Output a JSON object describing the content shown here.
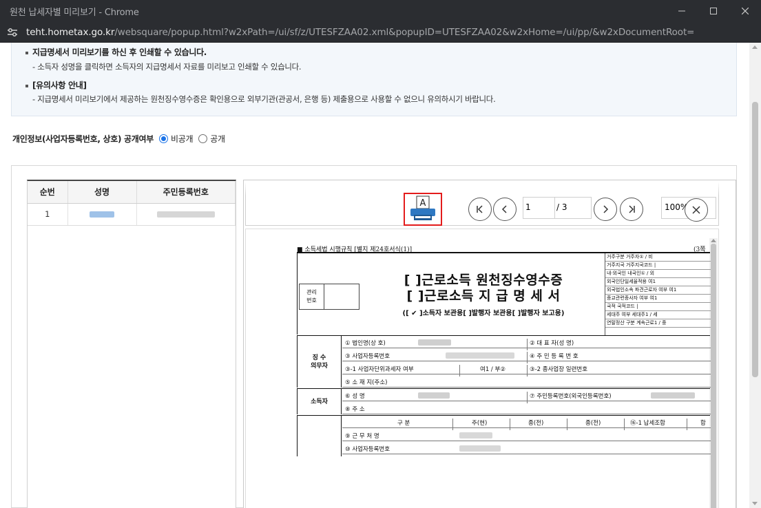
{
  "window": {
    "title": "원천 납세자별 미리보기 - Chrome",
    "url_host": "teht.hometax.go.kr",
    "url_path": "/websquare/popup.html?w2xPath=/ui/sf/z/UTESFZAA02.xml&popupID=UTESFZAA02&w2xHome=/ui/pp/&w2xDocumentRoot="
  },
  "notice": {
    "heading1": "지급명세서 미리보기를 하신 후 인쇄할 수 있습니다.",
    "sub1": "- 소득자 성명을 클릭하면 소득자의 지급명세서 자료를 미리보고 인쇄할 수 있습니다.",
    "heading2": "[유의사항 안내]",
    "sub2": "- 지급명세서 미리보기에서 제공하는 원천징수영수증은 확인용으로 외부기관(관공서, 은행 등) 제출용으로 사용할 수 없으니 유의하시기 바랍니다."
  },
  "privacy": {
    "label": "개인정보(사업자등록번호, 상호) 공개여부",
    "option_private": "비공개",
    "option_public": "공개",
    "selected": "비공개"
  },
  "list": {
    "headers": [
      "순번",
      "성명",
      "주민등록번호"
    ],
    "rows": [
      {
        "no": "1"
      }
    ]
  },
  "viewer": {
    "print_label": "A",
    "page_current": "1",
    "page_total": "/ 3",
    "zoom": "100%"
  },
  "doc": {
    "form_no": "■ 소득세법 시행규칙 [별지 제24호서식(1)]",
    "page_marker": "(3쪽",
    "mgmt_label": "관리\n번호",
    "title1": "[  ]근로소득 원천징수영수증",
    "title2": "[  ]근로소득 지 급 명 세 서",
    "title3": "([ ✔ ]소득자 보관용[    ]발행자 보관용[    ]발행자 보고용)",
    "side_rows": [
      "거주구분    거주자① / 비",
      "거주지국    거주지국코드 |",
      "내·외국인    내국인① / 외",
      "외국인단일세율적용    여1",
      "외국법인소속 파견근로자 여부  여1",
      "종교관련종사자 여부   여1",
      "국적      국적코드 |",
      "세대주 여부    세대주1 / 세",
      "연말정산 구분  계속근로1 / 중"
    ],
    "withholder_label": "징 수\n의무자",
    "w_row1_a": "① 법인명(상 호)",
    "w_row1_b": "② 대 표 자(성   명)",
    "w_row2_a": "③ 사업자등록번호",
    "w_row2_b": "④ 주 민 등 록 번 호",
    "w_row3_a": "③-1 사업자단위과세자 여부",
    "w_row3_m": "여1 / 부②",
    "w_row3_b": "③-2 종사업장 일련번호",
    "w_row4": "⑤ 소 재 지(주소)",
    "earner_label": "소득자",
    "e_row1_a": "⑥ 성      명",
    "e_row1_b": "⑦ 주민등록번호(외국인등록번호)",
    "e_row2": "⑧ 주      소",
    "inc_header": [
      "구 분",
      "주(현)",
      "종(전)",
      "종(전)",
      "⑯-1 납세조합",
      "합"
    ],
    "inc_row1": "⑨ 근 무 처 명",
    "inc_row2": "⑩ 사업자등록번호"
  }
}
